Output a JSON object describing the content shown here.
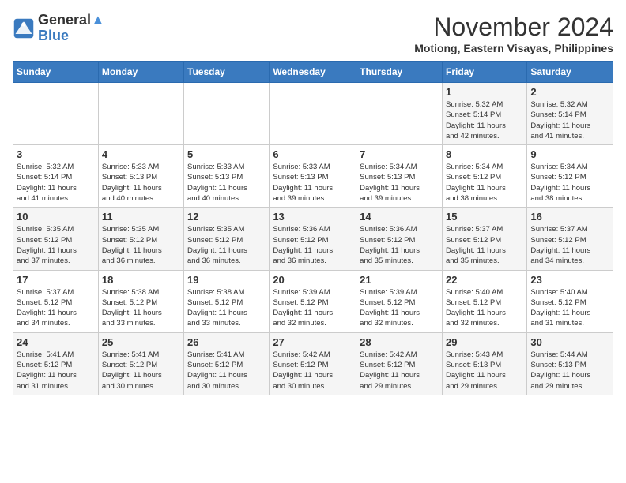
{
  "header": {
    "logo_line1": "General",
    "logo_line2": "Blue",
    "month_title": "November 2024",
    "location": "Motiong, Eastern Visayas, Philippines"
  },
  "weekdays": [
    "Sunday",
    "Monday",
    "Tuesday",
    "Wednesday",
    "Thursday",
    "Friday",
    "Saturday"
  ],
  "weeks": [
    [
      {
        "day": "",
        "info": ""
      },
      {
        "day": "",
        "info": ""
      },
      {
        "day": "",
        "info": ""
      },
      {
        "day": "",
        "info": ""
      },
      {
        "day": "",
        "info": ""
      },
      {
        "day": "1",
        "info": "Sunrise: 5:32 AM\nSunset: 5:14 PM\nDaylight: 11 hours\nand 42 minutes."
      },
      {
        "day": "2",
        "info": "Sunrise: 5:32 AM\nSunset: 5:14 PM\nDaylight: 11 hours\nand 41 minutes."
      }
    ],
    [
      {
        "day": "3",
        "info": "Sunrise: 5:32 AM\nSunset: 5:14 PM\nDaylight: 11 hours\nand 41 minutes."
      },
      {
        "day": "4",
        "info": "Sunrise: 5:33 AM\nSunset: 5:13 PM\nDaylight: 11 hours\nand 40 minutes."
      },
      {
        "day": "5",
        "info": "Sunrise: 5:33 AM\nSunset: 5:13 PM\nDaylight: 11 hours\nand 40 minutes."
      },
      {
        "day": "6",
        "info": "Sunrise: 5:33 AM\nSunset: 5:13 PM\nDaylight: 11 hours\nand 39 minutes."
      },
      {
        "day": "7",
        "info": "Sunrise: 5:34 AM\nSunset: 5:13 PM\nDaylight: 11 hours\nand 39 minutes."
      },
      {
        "day": "8",
        "info": "Sunrise: 5:34 AM\nSunset: 5:12 PM\nDaylight: 11 hours\nand 38 minutes."
      },
      {
        "day": "9",
        "info": "Sunrise: 5:34 AM\nSunset: 5:12 PM\nDaylight: 11 hours\nand 38 minutes."
      }
    ],
    [
      {
        "day": "10",
        "info": "Sunrise: 5:35 AM\nSunset: 5:12 PM\nDaylight: 11 hours\nand 37 minutes."
      },
      {
        "day": "11",
        "info": "Sunrise: 5:35 AM\nSunset: 5:12 PM\nDaylight: 11 hours\nand 36 minutes."
      },
      {
        "day": "12",
        "info": "Sunrise: 5:35 AM\nSunset: 5:12 PM\nDaylight: 11 hours\nand 36 minutes."
      },
      {
        "day": "13",
        "info": "Sunrise: 5:36 AM\nSunset: 5:12 PM\nDaylight: 11 hours\nand 36 minutes."
      },
      {
        "day": "14",
        "info": "Sunrise: 5:36 AM\nSunset: 5:12 PM\nDaylight: 11 hours\nand 35 minutes."
      },
      {
        "day": "15",
        "info": "Sunrise: 5:37 AM\nSunset: 5:12 PM\nDaylight: 11 hours\nand 35 minutes."
      },
      {
        "day": "16",
        "info": "Sunrise: 5:37 AM\nSunset: 5:12 PM\nDaylight: 11 hours\nand 34 minutes."
      }
    ],
    [
      {
        "day": "17",
        "info": "Sunrise: 5:37 AM\nSunset: 5:12 PM\nDaylight: 11 hours\nand 34 minutes."
      },
      {
        "day": "18",
        "info": "Sunrise: 5:38 AM\nSunset: 5:12 PM\nDaylight: 11 hours\nand 33 minutes."
      },
      {
        "day": "19",
        "info": "Sunrise: 5:38 AM\nSunset: 5:12 PM\nDaylight: 11 hours\nand 33 minutes."
      },
      {
        "day": "20",
        "info": "Sunrise: 5:39 AM\nSunset: 5:12 PM\nDaylight: 11 hours\nand 32 minutes."
      },
      {
        "day": "21",
        "info": "Sunrise: 5:39 AM\nSunset: 5:12 PM\nDaylight: 11 hours\nand 32 minutes."
      },
      {
        "day": "22",
        "info": "Sunrise: 5:40 AM\nSunset: 5:12 PM\nDaylight: 11 hours\nand 32 minutes."
      },
      {
        "day": "23",
        "info": "Sunrise: 5:40 AM\nSunset: 5:12 PM\nDaylight: 11 hours\nand 31 minutes."
      }
    ],
    [
      {
        "day": "24",
        "info": "Sunrise: 5:41 AM\nSunset: 5:12 PM\nDaylight: 11 hours\nand 31 minutes."
      },
      {
        "day": "25",
        "info": "Sunrise: 5:41 AM\nSunset: 5:12 PM\nDaylight: 11 hours\nand 30 minutes."
      },
      {
        "day": "26",
        "info": "Sunrise: 5:41 AM\nSunset: 5:12 PM\nDaylight: 11 hours\nand 30 minutes."
      },
      {
        "day": "27",
        "info": "Sunrise: 5:42 AM\nSunset: 5:12 PM\nDaylight: 11 hours\nand 30 minutes."
      },
      {
        "day": "28",
        "info": "Sunrise: 5:42 AM\nSunset: 5:12 PM\nDaylight: 11 hours\nand 29 minutes."
      },
      {
        "day": "29",
        "info": "Sunrise: 5:43 AM\nSunset: 5:13 PM\nDaylight: 11 hours\nand 29 minutes."
      },
      {
        "day": "30",
        "info": "Sunrise: 5:44 AM\nSunset: 5:13 PM\nDaylight: 11 hours\nand 29 minutes."
      }
    ]
  ]
}
